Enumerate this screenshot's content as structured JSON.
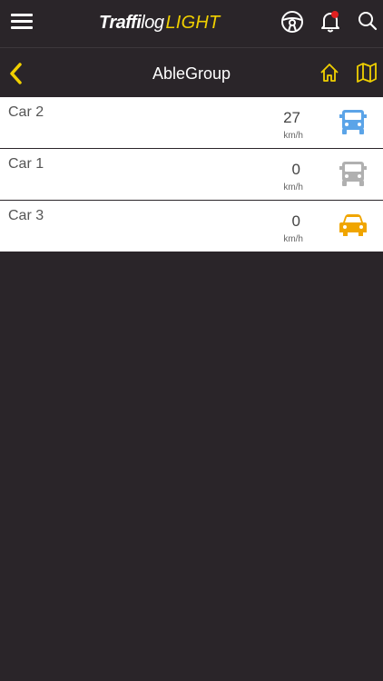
{
  "app": {
    "logo_bold": "Traffi",
    "logo_light": "log",
    "logo_suffix": "LIGHT"
  },
  "colors": {
    "background": "#2a2529",
    "accent": "#f0d000",
    "truck_moving": "#5ba4e8",
    "truck_idle": "#b0b0b0",
    "car": "#f0a500",
    "notification_dot": "#e02020"
  },
  "header": {
    "icons": [
      "menu-icon",
      "steering-wheel-icon",
      "bell-icon",
      "search-icon"
    ]
  },
  "nav": {
    "title": "AbleGroup",
    "icons": [
      "back-chevron-icon",
      "home-icon",
      "map-icon"
    ]
  },
  "vehicles": [
    {
      "name": "Car 2",
      "speed": "27",
      "unit": "km/h",
      "icon": "truck-icon",
      "status_color": "#5ba4e8"
    },
    {
      "name": "Car 1",
      "speed": "0",
      "unit": "km/h",
      "icon": "truck-icon",
      "status_color": "#b0b0b0"
    },
    {
      "name": "Car 3",
      "speed": "0",
      "unit": "km/h",
      "icon": "car-icon",
      "status_color": "#f0a500"
    }
  ]
}
